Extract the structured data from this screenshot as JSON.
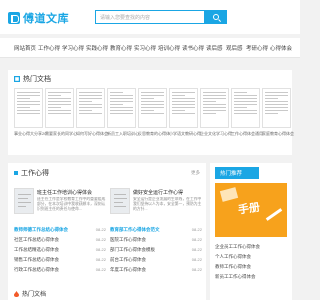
{
  "brand": {
    "name": "傅道文库",
    "accent": "#1aa6e4",
    "banner_color": "#f7a21c"
  },
  "search": {
    "placeholder": "请输入您要查找的内容"
  },
  "nav": [
    "网站首页",
    "工作心得",
    "学习心得",
    "实践心得",
    "教育心得",
    "实习心得",
    "培训心得",
    "读书心得",
    "读后感",
    "观后感",
    "考研心得",
    "心得体会"
  ],
  "hot_docs": {
    "title": "热门文档",
    "items": [
      "事业心得大分享2022年",
      "需要家长的同学心得",
      "如何写好心得体会范文",
      "新员工入职培训心得",
      "反思教育的心得体会",
      "小学语文教研心得体会",
      "企业文化学习心得体会",
      "工作心得体会通用范文",
      "家庭教育心得体会"
    ]
  },
  "work": {
    "title": "工作心得",
    "more": "更多",
    "cards": [
      {
        "title": "班主任工作培训心得体会",
        "desc": "班主任工作是学校教育工作中的重要组成部分，在本次培训中我收获颇丰，深刻认识到班主任的责任与使命..."
      },
      {
        "title": "做好安全运行工作心得",
        "desc": "安全运行是企业发展的生命线，在工作中我们坚持以人为本，安全第一，预防为主的方针..."
      }
    ],
    "list_left": [
      {
        "title": "教师师德工作总结心得体会",
        "date": "08-22"
      },
      {
        "title": "社区工作总结心得体会",
        "date": "08-22"
      },
      {
        "title": "工作总结精选心得体会",
        "date": "08-22"
      },
      {
        "title": "销售工作总结心得体会",
        "date": "08-22"
      },
      {
        "title": "行政工作总结心得体会",
        "date": "08-22"
      }
    ],
    "list_right": [
      {
        "title": "教育部工作心得体会范文",
        "date": "08-22"
      },
      {
        "title": "医院工作心得体会",
        "date": "08-22"
      },
      {
        "title": "部门工作心得体会模板",
        "date": "08-22"
      },
      {
        "title": "前台工作心得体会",
        "date": "08-22"
      },
      {
        "title": "年度工作心得体会",
        "date": "08-22"
      }
    ]
  },
  "side": {
    "title": "热门推荐",
    "banner_text": "手册",
    "items": [
      "企业员工工作心得体会",
      "个人工作心得体会",
      "教师工作心得体会",
      "新员工工作心得体会"
    ]
  },
  "bottom": {
    "title": "热门文档"
  }
}
